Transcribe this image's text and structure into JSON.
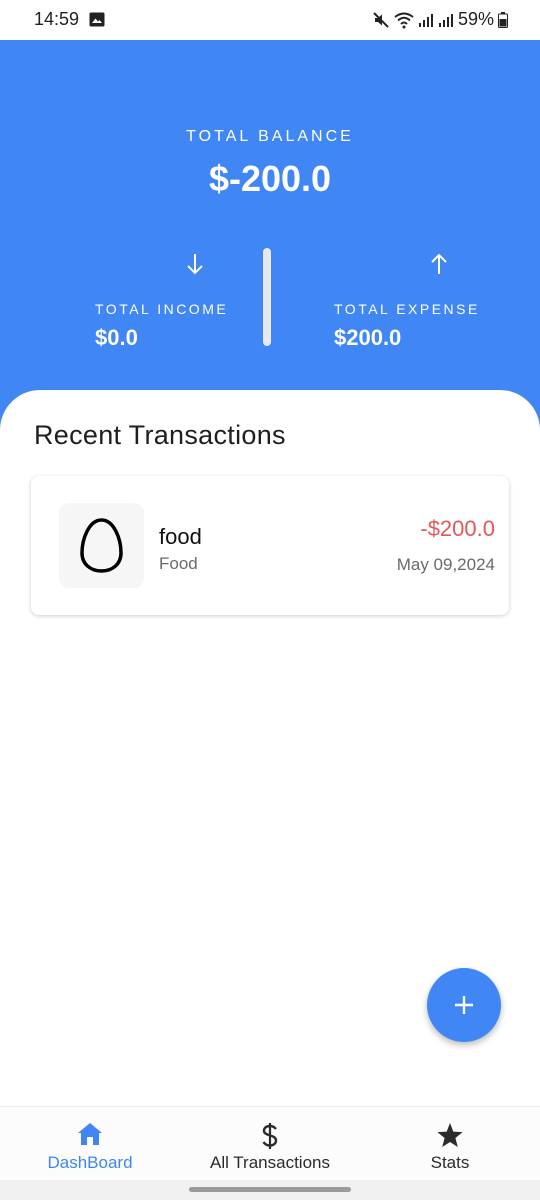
{
  "status_bar": {
    "time": "14:59",
    "battery": "59%",
    "icons": [
      "gallery-icon",
      "mute-icon",
      "wifi-icon",
      "signal-icon",
      "signal-icon",
      "battery-icon"
    ]
  },
  "header": {
    "balance_label": "TOTAL BALANCE",
    "balance_value": "$-200.0",
    "income_label": "TOTAL INCOME",
    "income_value": "$0.0",
    "expense_label": "TOTAL EXPENSE",
    "expense_value": "$200.0",
    "accent_color": "#4087f5"
  },
  "recent": {
    "title": "Recent Transactions",
    "transactions": [
      {
        "name": "food",
        "category": "Food",
        "amount": "-$200.0",
        "date": "May 09,2024",
        "icon": "egg-icon",
        "amount_color": "#e05a57"
      }
    ]
  },
  "fab": {
    "icon": "plus-icon"
  },
  "bottom_nav": {
    "items": [
      {
        "label": "DashBoard",
        "icon": "home-icon",
        "active": true
      },
      {
        "label": "All Transactions",
        "icon": "dollar-icon",
        "active": false
      },
      {
        "label": "Stats",
        "icon": "star-icon",
        "active": false
      }
    ],
    "active_color": "#3f86f3"
  }
}
